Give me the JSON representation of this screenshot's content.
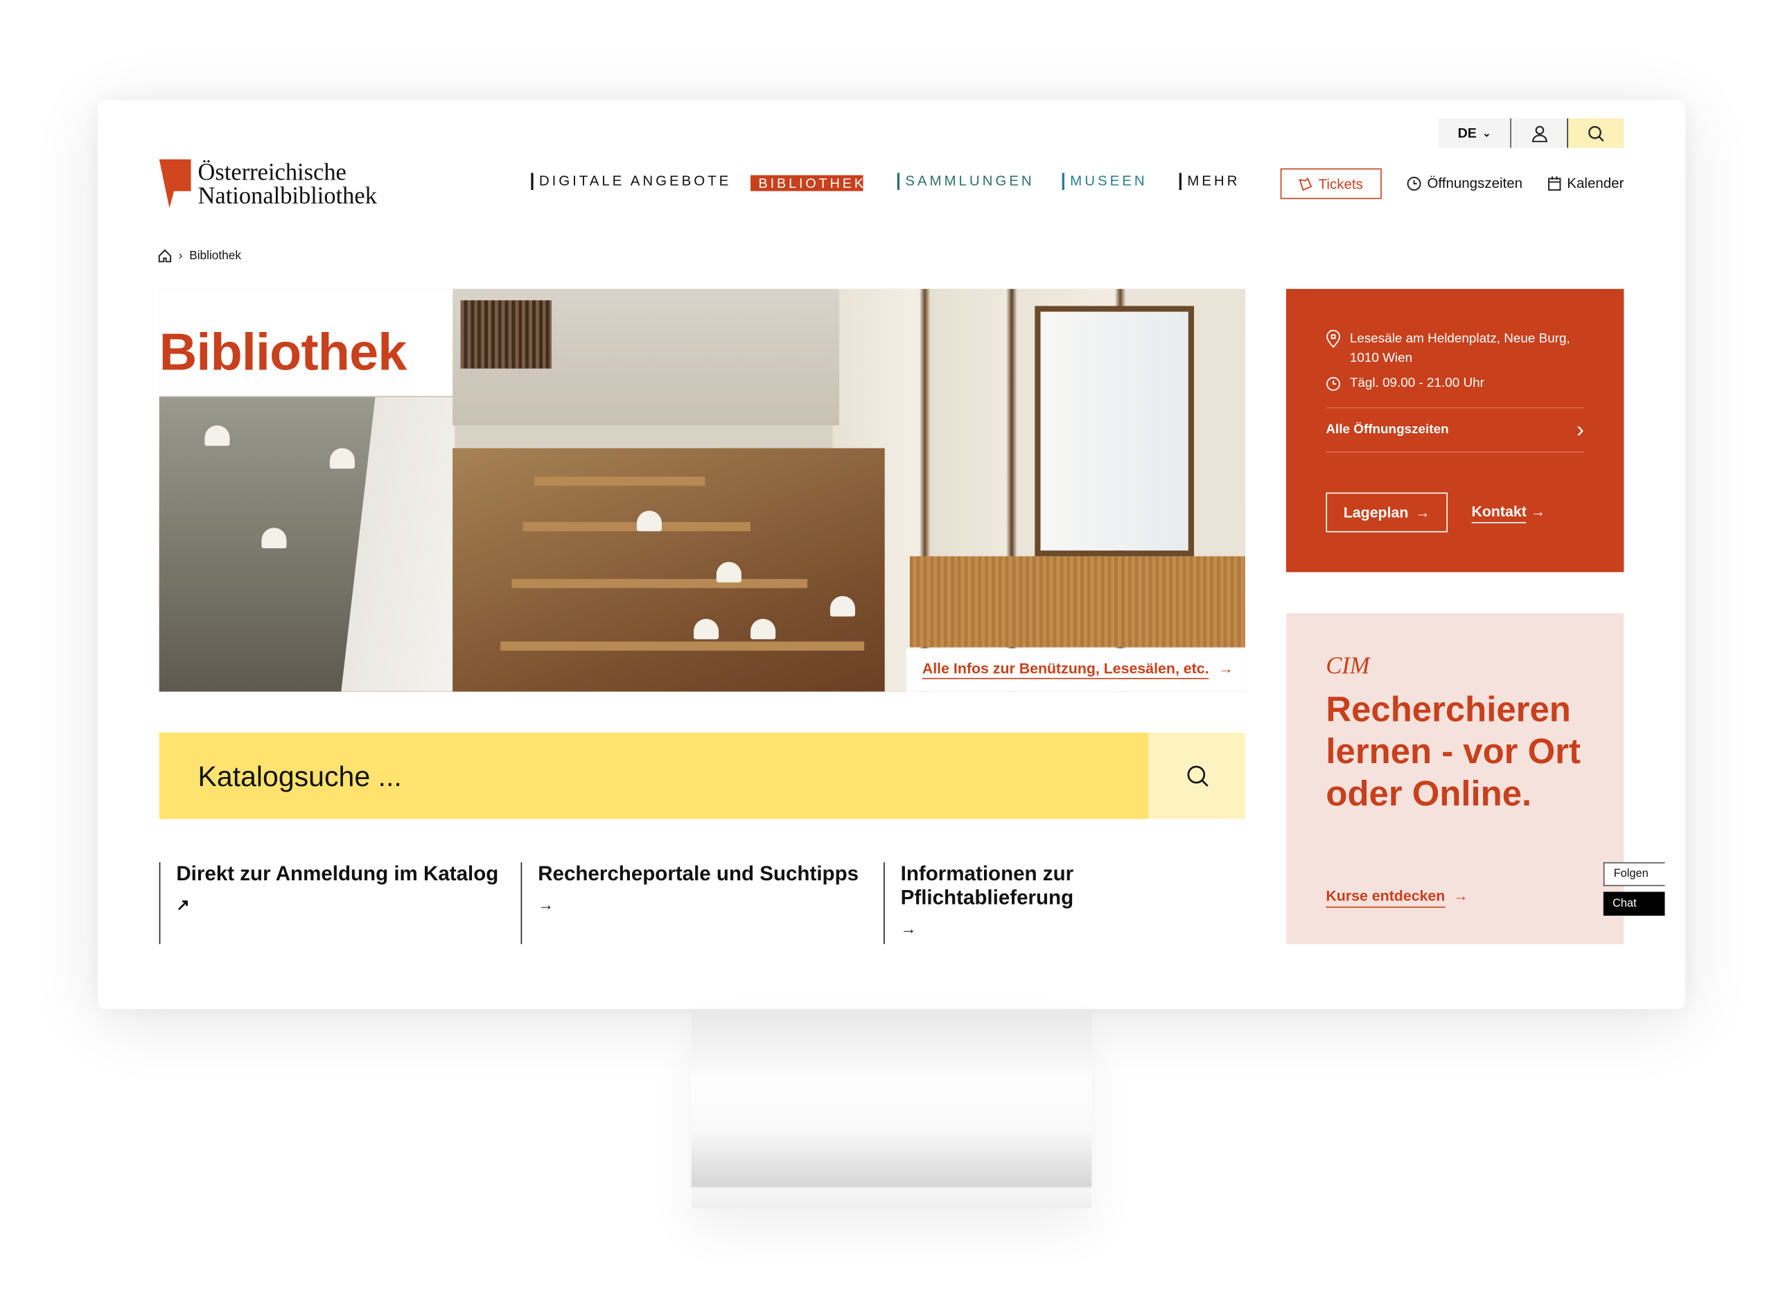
{
  "header": {
    "logo_line1": "Österreichische",
    "logo_line2": "Nationalbibliothek",
    "language": "DE",
    "nav": [
      {
        "label": "DIGITALE ANGEBOTE",
        "color": "#111111"
      },
      {
        "label": "BIBLIOTHEK",
        "color": "#ffffff",
        "active": true
      },
      {
        "label": "SAMMLUNGEN",
        "color": "#2f6f6f"
      },
      {
        "label": "MUSEEN",
        "color": "#2a7a95"
      },
      {
        "label": "MEHR",
        "color": "#111111"
      }
    ],
    "tickets": "Tickets",
    "opening_hours": "Öffnungszeiten",
    "calendar": "Kalender"
  },
  "breadcrumb": {
    "current": "Bibliothek"
  },
  "hero": {
    "title": "Bibliothek",
    "link": "Alle Infos zur Benützung, Lesesälen, etc."
  },
  "search": {
    "placeholder": "Katalogsuche ..."
  },
  "quick_links": [
    {
      "label": "Direkt zur Anmeldung im Katalog",
      "arrow": "↗"
    },
    {
      "label": "Rechercheportale und Suchtipps",
      "arrow": "→"
    },
    {
      "label": "Informationen zur Pflichtablieferung",
      "arrow": "→"
    }
  ],
  "info_card": {
    "address": "Lesesäle am Heldenplatz, Neue Burg, 1010 Wien",
    "hours": "Tägl. 09.00 - 21.00 Uhr",
    "all_hours": "Alle Öffnungszeiten",
    "map_button": "Lageplan",
    "contact_link": "Kontakt"
  },
  "promo": {
    "kicker": "CIM",
    "title": "Recherchieren lernen - vor Ort oder Online.",
    "link": "Kurse entdecken"
  },
  "side_buttons": {
    "follow": "Folgen",
    "chat": "Chat"
  },
  "colors": {
    "brand": "#c8401c",
    "search_yellow": "#ffe36e",
    "promo_bg": "#f6e2dd"
  }
}
